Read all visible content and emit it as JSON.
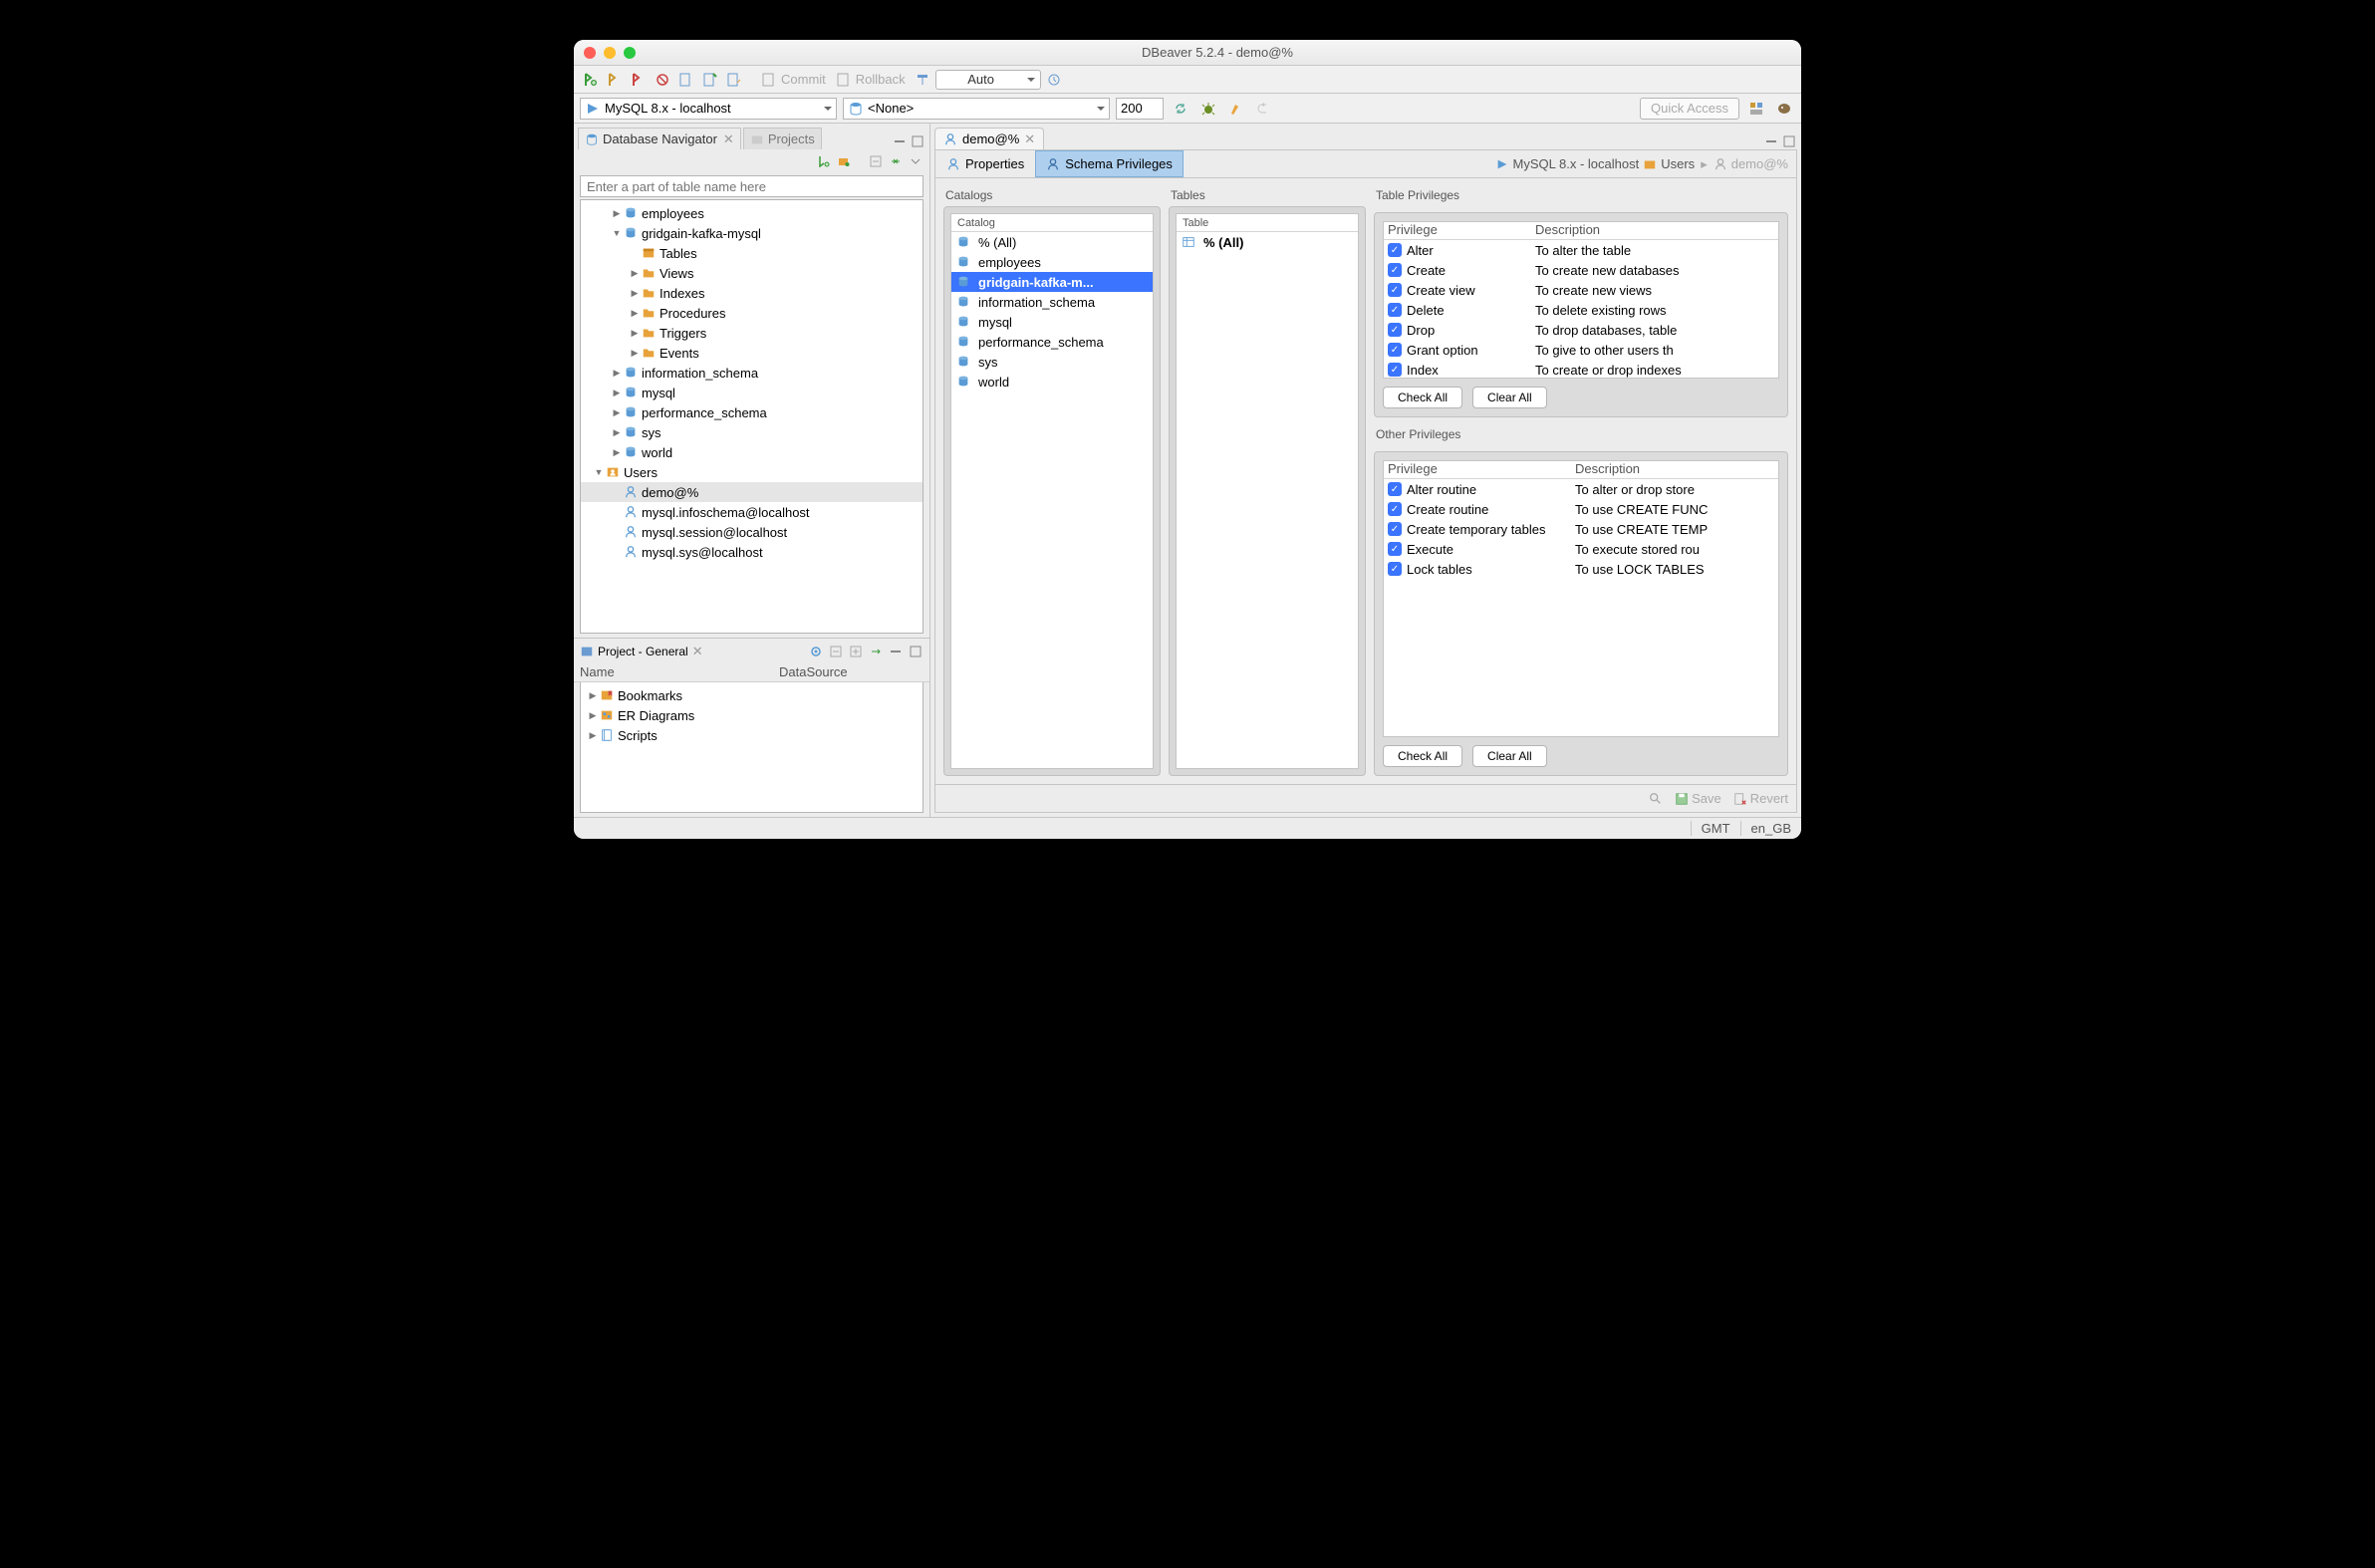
{
  "window": {
    "title": "DBeaver 5.2.4 - demo@%"
  },
  "toolbar": {
    "commit": "Commit",
    "rollback": "Rollback",
    "auto": "Auto",
    "conn": "MySQL 8.x - localhost",
    "db": "<None>",
    "rows": "200",
    "quick": "Quick Access"
  },
  "nav": {
    "tab1": "Database Navigator",
    "tab2": "Projects",
    "search_ph": "Enter a part of table name here",
    "nodes": [
      {
        "d": 1,
        "tw": "closed",
        "ic": "db",
        "label": "employees"
      },
      {
        "d": 1,
        "tw": "open",
        "ic": "db",
        "label": "gridgain-kafka-mysql"
      },
      {
        "d": 2,
        "tw": "none",
        "ic": "tables",
        "label": "Tables"
      },
      {
        "d": 2,
        "tw": "closed",
        "ic": "folder",
        "label": "Views"
      },
      {
        "d": 2,
        "tw": "closed",
        "ic": "folder",
        "label": "Indexes"
      },
      {
        "d": 2,
        "tw": "closed",
        "ic": "folder",
        "label": "Procedures"
      },
      {
        "d": 2,
        "tw": "closed",
        "ic": "folder",
        "label": "Triggers"
      },
      {
        "d": 2,
        "tw": "closed",
        "ic": "folder",
        "label": "Events"
      },
      {
        "d": 1,
        "tw": "closed",
        "ic": "db",
        "label": "information_schema"
      },
      {
        "d": 1,
        "tw": "closed",
        "ic": "db",
        "label": "mysql"
      },
      {
        "d": 1,
        "tw": "closed",
        "ic": "db",
        "label": "performance_schema"
      },
      {
        "d": 1,
        "tw": "closed",
        "ic": "db",
        "label": "sys"
      },
      {
        "d": 1,
        "tw": "closed",
        "ic": "db",
        "label": "world"
      },
      {
        "d": 0,
        "tw": "open",
        "ic": "users",
        "label": "Users"
      },
      {
        "d": 1,
        "tw": "none",
        "ic": "user",
        "label": "demo@%",
        "sel": true
      },
      {
        "d": 1,
        "tw": "none",
        "ic": "user",
        "label": "mysql.infoschema@localhost"
      },
      {
        "d": 1,
        "tw": "none",
        "ic": "user",
        "label": "mysql.session@localhost"
      },
      {
        "d": 1,
        "tw": "none",
        "ic": "user",
        "label": "mysql.sys@localhost"
      }
    ]
  },
  "project": {
    "title": "Project - General",
    "cols": {
      "name": "Name",
      "ds": "DataSource"
    },
    "items": [
      {
        "ic": "bookmark",
        "label": "Bookmarks"
      },
      {
        "ic": "er",
        "label": "ER Diagrams"
      },
      {
        "ic": "script",
        "label": "Scripts"
      }
    ]
  },
  "editor": {
    "tab": "demo@%",
    "page_properties": "Properties",
    "page_schema": "Schema Privileges",
    "crumbs": {
      "conn": "MySQL 8.x - localhost",
      "group": "Users",
      "user": "demo@%"
    }
  },
  "catalogs": {
    "title": "Catalogs",
    "header": "Catalog",
    "items": [
      {
        "label": "% (All)"
      },
      {
        "label": "employees"
      },
      {
        "label": "gridgain-kafka-m...",
        "sel": true,
        "bold": true
      },
      {
        "label": "information_schema"
      },
      {
        "label": "mysql"
      },
      {
        "label": "performance_schema"
      },
      {
        "label": "sys"
      },
      {
        "label": "world"
      }
    ]
  },
  "tables": {
    "title": "Tables",
    "header": "Table",
    "items": [
      {
        "label": "% (All)",
        "bold": true,
        "ic": "tbl"
      }
    ]
  },
  "table_privs": {
    "title": "Table Privileges",
    "cols": {
      "p": "Privilege",
      "d": "Description"
    },
    "rows": [
      {
        "p": "Alter",
        "d": "To alter the table"
      },
      {
        "p": "Create",
        "d": "To create new databases"
      },
      {
        "p": "Create view",
        "d": "To create new views"
      },
      {
        "p": "Delete",
        "d": "To delete existing rows"
      },
      {
        "p": "Drop",
        "d": "To drop databases, table"
      },
      {
        "p": "Grant option",
        "d": "To give to other users th"
      },
      {
        "p": "Index",
        "d": "To create or drop indexes"
      }
    ],
    "check_all": "Check All",
    "clear_all": "Clear All"
  },
  "other_privs": {
    "title": "Other Privileges",
    "cols": {
      "p": "Privilege",
      "d": "Description"
    },
    "rows": [
      {
        "p": "Alter routine",
        "d": "To alter or drop store"
      },
      {
        "p": "Create routine",
        "d": "To use CREATE FUNC"
      },
      {
        "p": "Create temporary tables",
        "d": "To use CREATE TEMP"
      },
      {
        "p": "Execute",
        "d": "To execute stored rou"
      },
      {
        "p": "Lock tables",
        "d": "To use LOCK TABLES"
      }
    ],
    "check_all": "Check All",
    "clear_all": "Clear All"
  },
  "footer": {
    "save": "Save",
    "revert": "Revert"
  },
  "status": {
    "tz": "GMT",
    "locale": "en_GB"
  }
}
